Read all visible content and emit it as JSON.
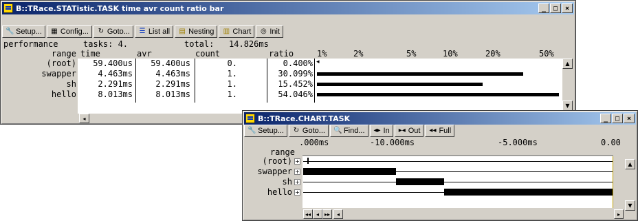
{
  "stat_window": {
    "title": "B::TRace.STATistic.TASK time avr count ratio bar",
    "window_buttons": [
      "_",
      "□",
      "×"
    ],
    "toolbar": [
      {
        "label": "Setup...",
        "icon": "wrench-icon"
      },
      {
        "label": "Config...",
        "icon": "grid-icon"
      },
      {
        "label": "Goto...",
        "icon": "goto-icon"
      },
      {
        "label": "List all",
        "icon": "list-icon"
      },
      {
        "label": "Nesting",
        "icon": "nesting-icon"
      },
      {
        "label": "Chart",
        "icon": "chart-icon"
      },
      {
        "label": "Init",
        "icon": "init-icon"
      }
    ],
    "summary_label": "performance",
    "summary_tasks": "tasks: 4.",
    "summary_total": "total:   14.826ms",
    "headers": {
      "range": "range",
      "time": "time",
      "avr": "avr",
      "count": "count",
      "ratio": "ratio"
    },
    "scale_labels": [
      "1%",
      "2%",
      "5%",
      "10%",
      "20%",
      "50%"
    ],
    "rows": [
      {
        "range": "(root)",
        "time": "59.400us",
        "avr": "59.400us",
        "count": "0.",
        "ratio": "0.400%",
        "ratio_value": 0.4
      },
      {
        "range": "swapper",
        "time": "4.463ms",
        "avr": "4.463ms",
        "count": "1.",
        "ratio": "30.099%",
        "ratio_value": 30.099
      },
      {
        "range": "sh",
        "time": "2.291ms",
        "avr": "2.291ms",
        "count": "1.",
        "ratio": "15.452%",
        "ratio_value": 15.452
      },
      {
        "range": "hello",
        "time": "8.013ms",
        "avr": "8.013ms",
        "count": "1.",
        "ratio": "54.046%",
        "ratio_value": 54.046
      }
    ]
  },
  "chart_window": {
    "title": "B::TRace.CHART.TASK",
    "window_buttons": [
      "_",
      "□",
      "×"
    ],
    "toolbar": [
      {
        "label": "Setup...",
        "icon": "wrench-icon"
      },
      {
        "label": "Goto...",
        "icon": "goto-icon"
      },
      {
        "label": "Find...",
        "icon": "find-icon"
      },
      {
        "label": "In",
        "icon": "zoom-in-icon"
      },
      {
        "label": "Out",
        "icon": "zoom-out-icon"
      },
      {
        "label": "Full",
        "icon": "zoom-full-icon"
      }
    ],
    "range_label": "range",
    "time_labels": [
      ".000ms",
      "-10.000ms",
      "-5.000ms",
      "0.00"
    ],
    "rows": [
      {
        "range": "(root)",
        "segments": []
      },
      {
        "range": "swapper",
        "segments": [
          [
            0.0,
            0.3
          ]
        ]
      },
      {
        "range": "sh",
        "segments": [
          [
            0.3,
            0.455
          ]
        ]
      },
      {
        "range": "hello",
        "segments": [
          [
            0.455,
            1.0
          ]
        ]
      }
    ],
    "nav_buttons": [
      "◂◂",
      "◂",
      "▸▸"
    ]
  }
}
